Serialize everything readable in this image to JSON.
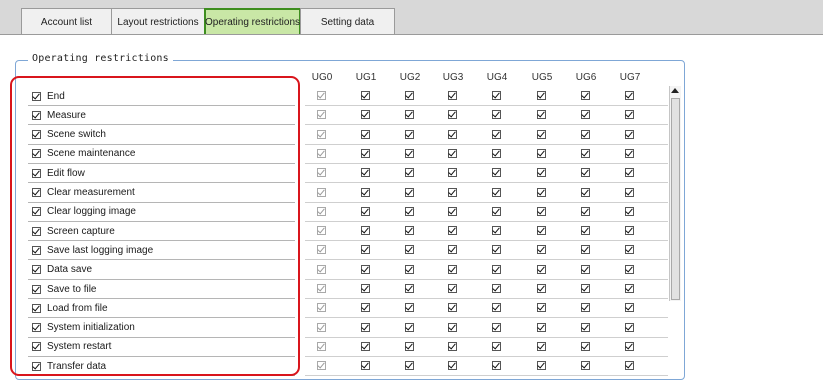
{
  "tabs": [
    {
      "label": "Account list"
    },
    {
      "label": "Layout restrictions"
    },
    {
      "label": "Operating restrictions",
      "active": true
    },
    {
      "label": "Setting data"
    }
  ],
  "group_title": "Operating restrictions",
  "columns": [
    "UG0",
    "UG1",
    "UG2",
    "UG3",
    "UG4",
    "UG5",
    "UG6",
    "UG7"
  ],
  "rows": [
    {
      "label": "End"
    },
    {
      "label": "Measure"
    },
    {
      "label": "Scene switch"
    },
    {
      "label": "Scene maintenance"
    },
    {
      "label": "Edit flow"
    },
    {
      "label": "Clear measurement"
    },
    {
      "label": "Clear logging image"
    },
    {
      "label": "Screen capture"
    },
    {
      "label": "Save last logging image"
    },
    {
      "label": "Data save"
    },
    {
      "label": "Save to file"
    },
    {
      "label": "Load from file"
    },
    {
      "label": "System initialization"
    },
    {
      "label": "System restart"
    },
    {
      "label": "Transfer data"
    }
  ],
  "colors": {
    "active_tab_bg": "#c9e7a6",
    "active_tab_border": "#3e8e1f",
    "group_border": "#7fa7d6",
    "highlight": "#d9151c"
  }
}
